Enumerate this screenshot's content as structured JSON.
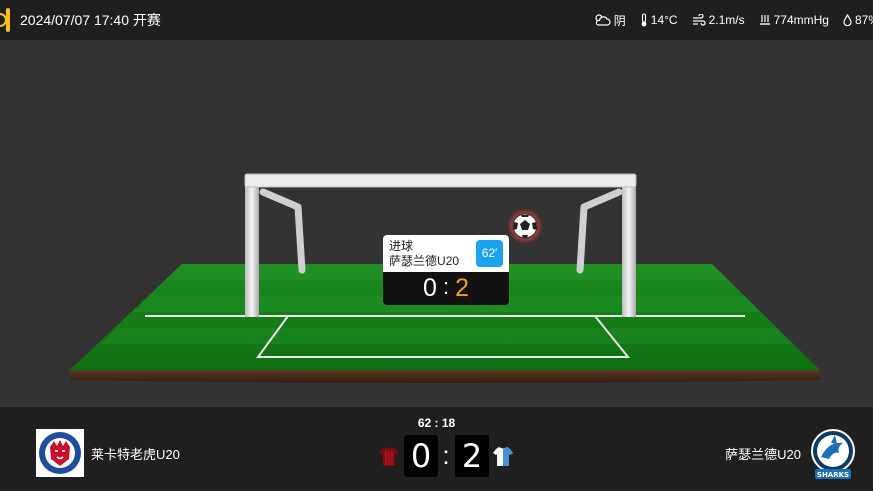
{
  "header": {
    "match_time": "2024/07/07 17:40 开赛",
    "weather": {
      "condition": "阴",
      "temperature": "14°C",
      "wind": "2.1m/s",
      "pressure": "774mmHg",
      "humidity": "87%"
    },
    "accent_color": "#f5c518"
  },
  "event": {
    "type": "进球",
    "team": "萨瑟兰德U20",
    "minute": "62′",
    "score_home": "0",
    "score_separator": ":",
    "score_away": "2",
    "minute_badge_color": "#1aa3f0",
    "away_score_color": "#f0a500"
  },
  "scoreboard": {
    "clock": "62 : 18",
    "home_team": "莱卡特老虎U20",
    "away_team": "萨瑟兰德U20",
    "home_score": "0",
    "separator": ":",
    "away_score": "2",
    "home_logo_text": "FOOTBALL CLUB",
    "away_logo_text": "SHARKS"
  }
}
